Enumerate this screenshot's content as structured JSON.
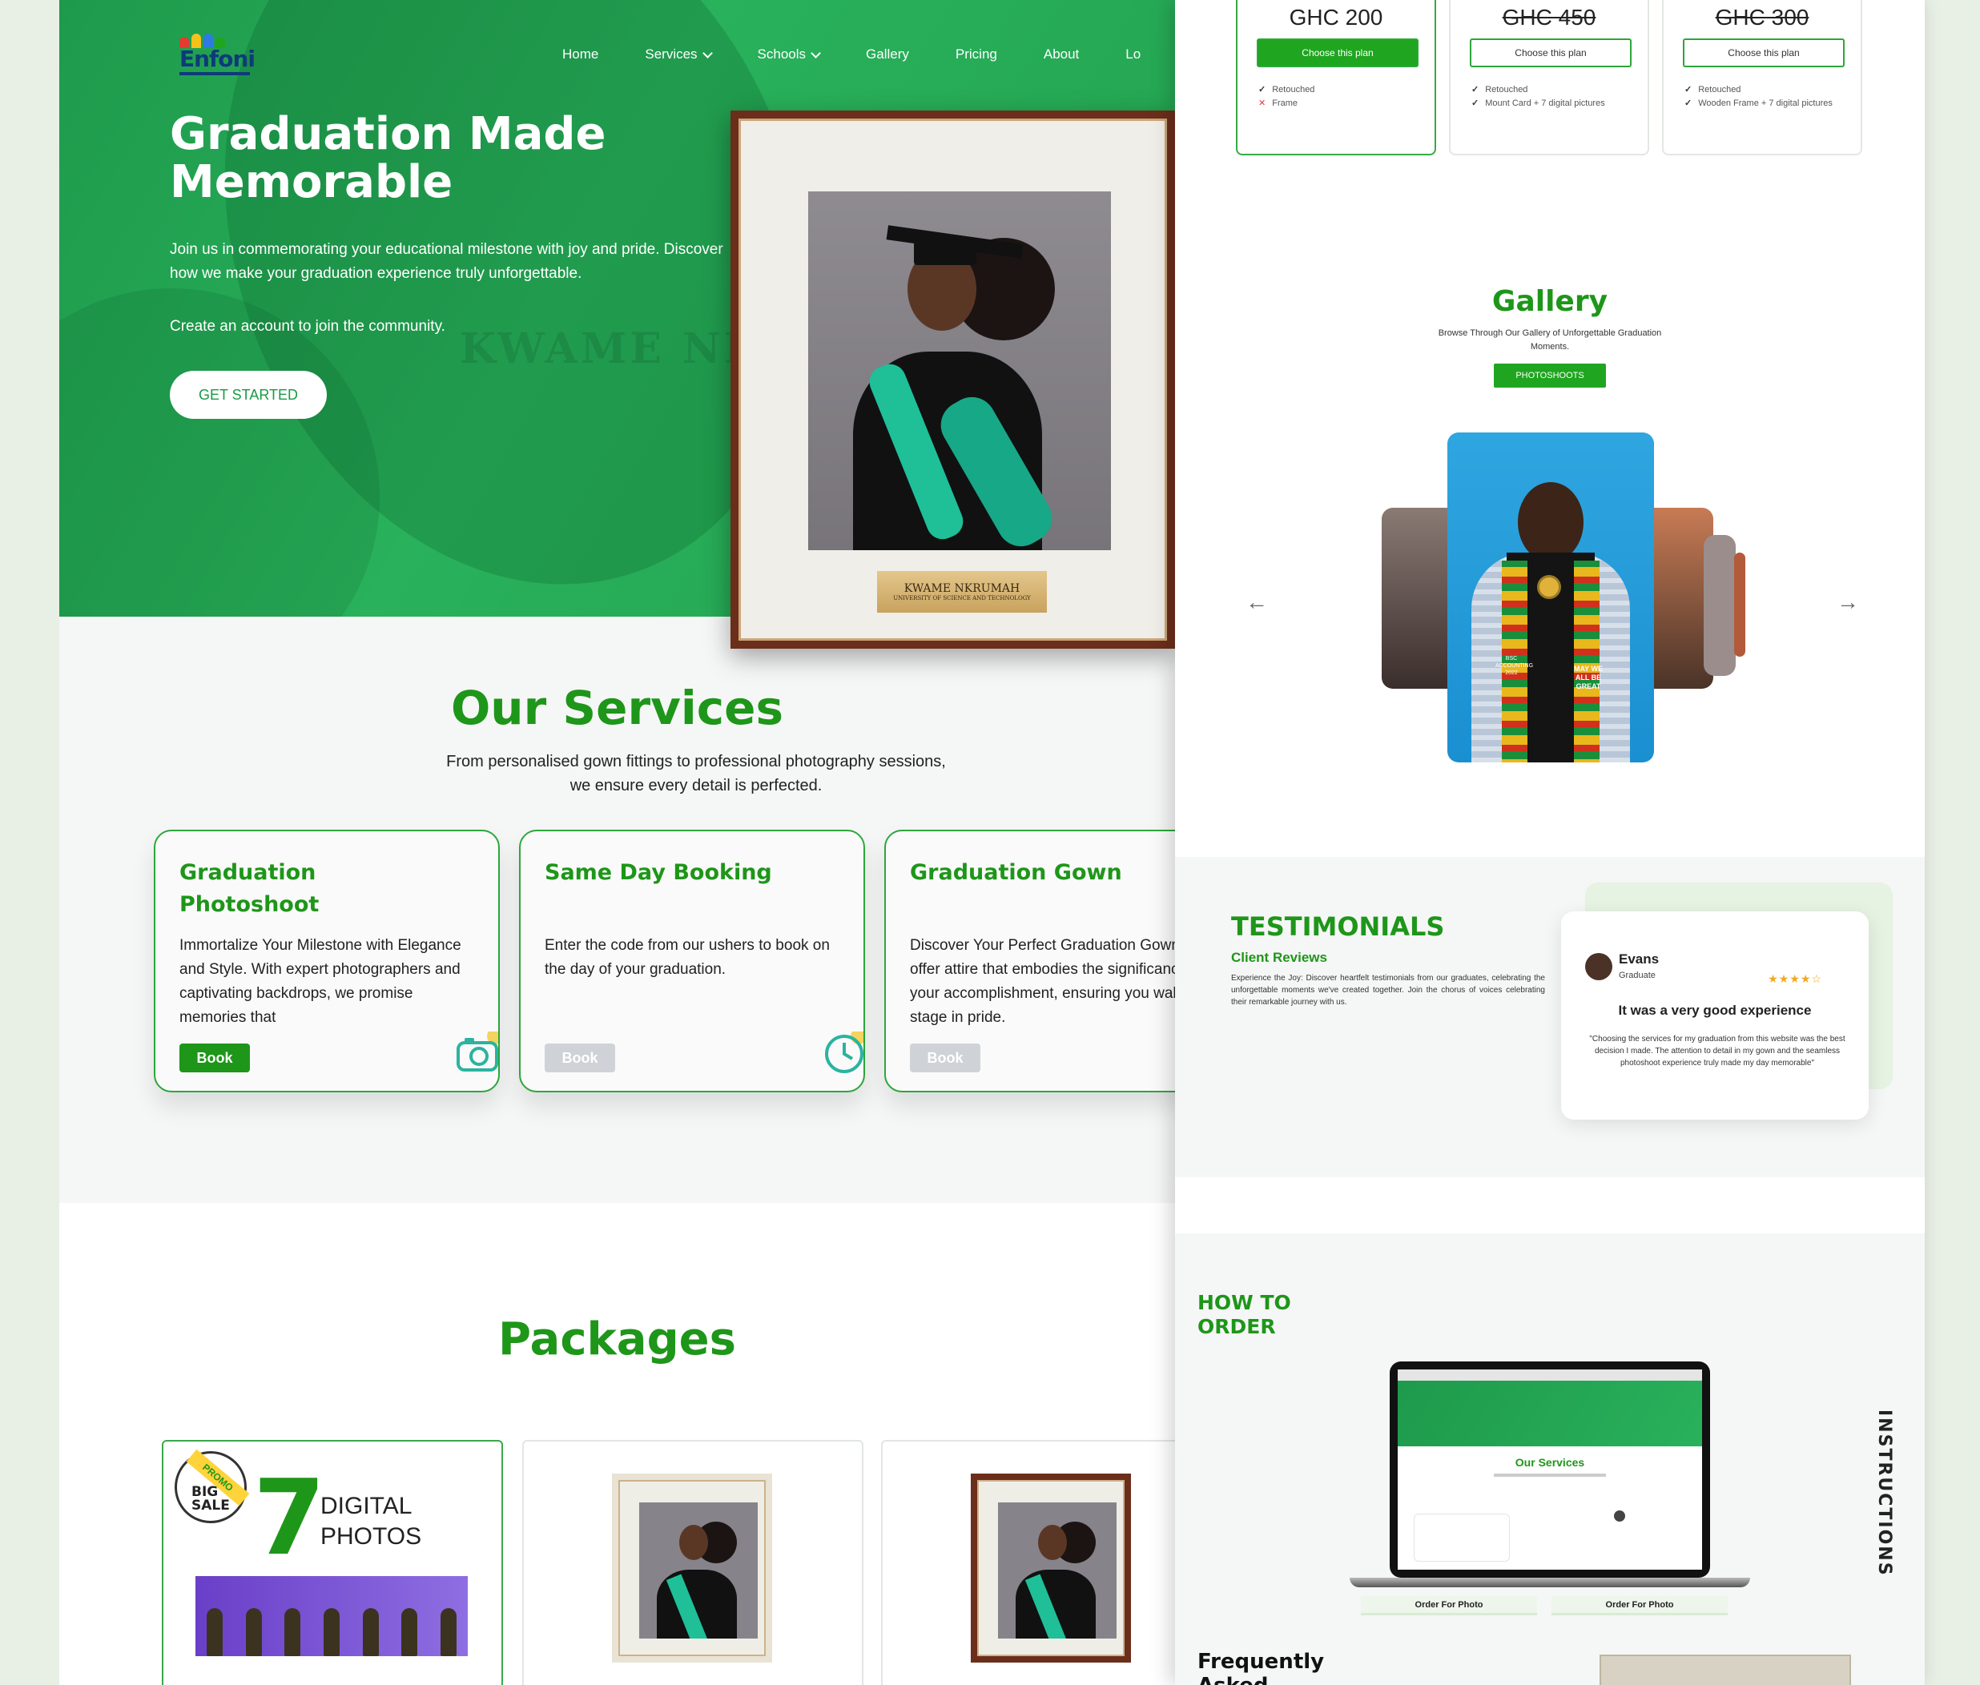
{
  "brand": {
    "name": "Enfoni",
    "colors": {
      "primary": "#1e9619",
      "hero": "#29b15b"
    }
  },
  "nav": {
    "home": "Home",
    "services": "Services",
    "schools": "Schools",
    "gallery": "Gallery",
    "pricing": "Pricing",
    "about": "About",
    "login": "Lo"
  },
  "hero": {
    "title": "Graduation Made Memorable",
    "lead": "Join us in commemorating your educational milestone with joy and pride. Discover how we make your graduation experience truly unforgettable.",
    "cta_text": "Create an account to join the community.",
    "button": "GET STARTED",
    "watermark": "KWAME NKRUMAH UNIVERSITY",
    "plaque_title": "KWAME NKRUMAH",
    "plaque_sub": "UNIVERSITY OF SCIENCE AND TECHNOLOGY"
  },
  "services": {
    "title": "Our Services",
    "subtitle": "From personalised gown fittings to professional photography sessions, we ensure every detail is perfected.",
    "cards": [
      {
        "title": "Graduation Photoshoot",
        "text": "Immortalize Your Milestone with Elegance and Style. With expert photographers and captivating backdrops, we promise memories that",
        "button": "Book",
        "icon": "camera-icon",
        "enabled": true
      },
      {
        "title": "Same Day Booking",
        "text": "Enter the code from our ushers to book on the day of your graduation.",
        "button": "Book",
        "icon": "clock-icon",
        "enabled": false
      },
      {
        "title": "Graduation Gown",
        "text": "Discover Your Perfect Graduation Gown. We offer attire that embodies the significance of your accomplishment, ensuring you walk the stage in pride.",
        "button": "Book",
        "icon": "gown-icon",
        "enabled": false
      }
    ]
  },
  "packages": {
    "title": "Packages",
    "promo_ribbon": "PROMO",
    "promo_badge": "BIG SALE",
    "promo_number": "7",
    "promo_label": "DIGITAL PHOTOS"
  },
  "pricing": {
    "plans": [
      {
        "price": "GHC 200",
        "strike": false,
        "button": "Choose this plan",
        "features": [
          {
            "text": "Retouched",
            "ok": true
          },
          {
            "text": "Frame",
            "ok": false
          }
        ]
      },
      {
        "price": "GHC 450",
        "strike": true,
        "button": "Choose this plan",
        "features": [
          {
            "text": "Retouched",
            "ok": true
          },
          {
            "text": "Mount Card + 7 digital pictures",
            "ok": true
          }
        ]
      },
      {
        "price": "GHC 300",
        "strike": true,
        "button": "Choose this plan",
        "features": [
          {
            "text": "Retouched",
            "ok": true
          },
          {
            "text": "Wooden Frame + 7 digital pictures",
            "ok": true
          }
        ]
      }
    ]
  },
  "gallery": {
    "title": "Gallery",
    "subtitle": "Browse Through Our Gallery of Unforgettable Graduation Moments.",
    "button": "PHOTOSHOOTS",
    "kente_text": "MAY WE ALL BE GREAT",
    "kente_left": "BSC ACCOUNTING 2022"
  },
  "testimonials": {
    "title": "TESTIMONIALS",
    "kicker": "Client Reviews",
    "text": "Experience the Joy: Discover heartfelt testimonials from our graduates, celebrating the unforgettable moments we've created together. Join the chorus of voices celebrating their remarkable journey with us.",
    "review": {
      "name": "Evans",
      "role": "Graduate",
      "stars": "★★★★☆",
      "headline": "It was a very good experience",
      "quote": "\"Choosing the services for my graduation from this website was the best decision I made. The attention to detail in my gown and the seamless photoshoot experience truly made my day memorable\""
    }
  },
  "how_to_order": {
    "title": "HOW TO ORDER",
    "side_label": "INSTRUCTIONS",
    "screen_title": "Our Services",
    "step1": "Order For Photo",
    "step2": "Order For Photo"
  },
  "faq": {
    "title": "Frequently Asked Questions"
  }
}
